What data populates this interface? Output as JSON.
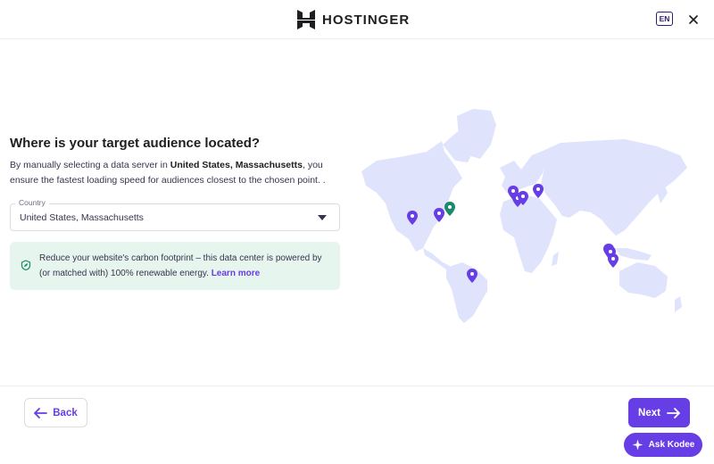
{
  "header": {
    "brand": "HOSTINGER",
    "language": "EN"
  },
  "main": {
    "title": "Where is your target audience located?",
    "description_before": "By manually selecting a data server in ",
    "description_bold": "United States, Massachusetts",
    "description_after": ", you ensure the fastest loading speed for audiences closest to the chosen point. .",
    "country_select": {
      "label": "Country",
      "value": "United States, Massachusetts"
    },
    "eco_notice": {
      "text": "Reduce your website's carbon footprint – this data center is powered by (or matched with) 100% renewable energy.",
      "link": "Learn more"
    }
  },
  "map": {
    "land_color": "#dfe3fb",
    "pin_color": "#673de6",
    "selected_pin_color": "#1a8a6a",
    "locations": [
      {
        "name": "USA West",
        "selected": false
      },
      {
        "name": "USA Central",
        "selected": false
      },
      {
        "name": "USA Massachusetts",
        "selected": true
      },
      {
        "name": "United Kingdom",
        "selected": false
      },
      {
        "name": "France",
        "selected": false
      },
      {
        "name": "Netherlands",
        "selected": false
      },
      {
        "name": "Germany",
        "selected": false
      },
      {
        "name": "Lithuania",
        "selected": false
      },
      {
        "name": "Brazil",
        "selected": false
      },
      {
        "name": "Malaysia",
        "selected": false
      },
      {
        "name": "Singapore",
        "selected": false
      },
      {
        "name": "Indonesia",
        "selected": false
      }
    ]
  },
  "footer": {
    "back_label": "Back",
    "next_label": "Next",
    "kodee_label": "Ask Kodee"
  },
  "colors": {
    "accent": "#673de6",
    "eco_bg": "#e6f5ee",
    "eco_icon": "#1a8a6a"
  }
}
